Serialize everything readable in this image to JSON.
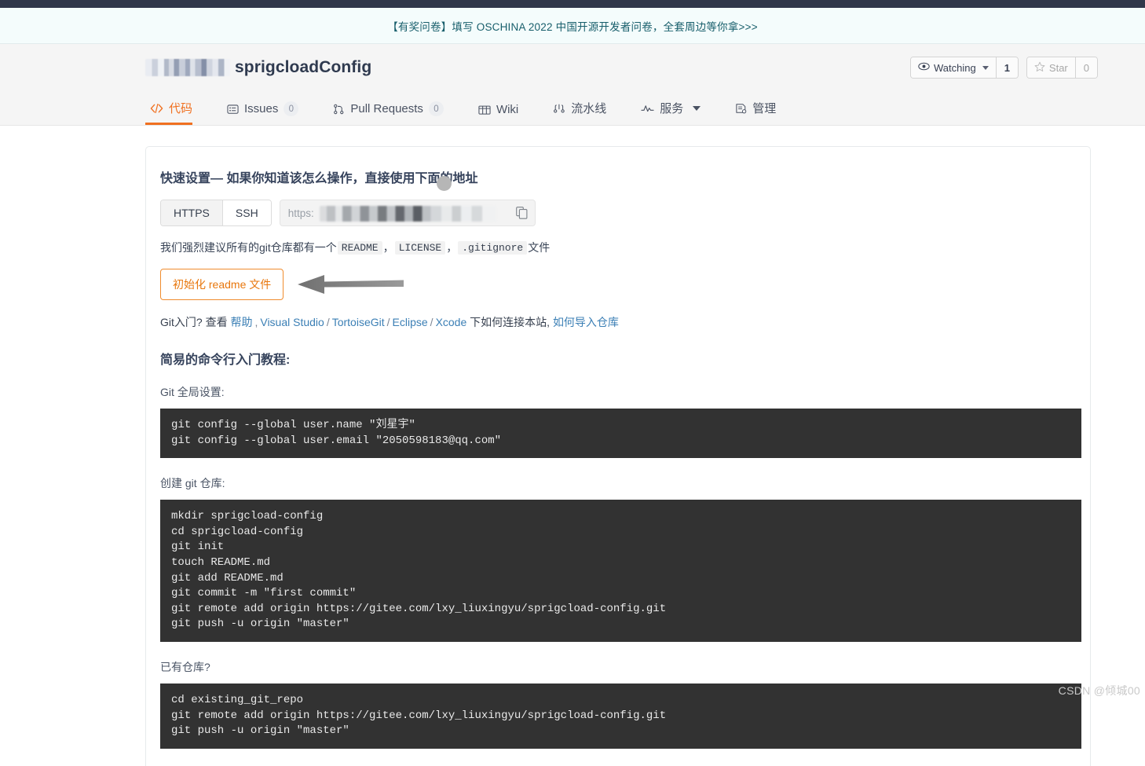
{
  "banner": {
    "text": "【有奖问卷】填写 OSCHINA 2022 中国开源开发者问卷，全套周边等你拿>>>"
  },
  "repo": {
    "owner_redacted": "",
    "name": "sprigcloadConfig",
    "watch": {
      "icon": "eye-icon",
      "label": "Watching",
      "count": "1"
    },
    "star": {
      "icon": "star-icon",
      "label": "Star",
      "count": "0"
    }
  },
  "tabs": [
    {
      "id": "code",
      "icon": "code-icon",
      "label": "代码",
      "badge": null,
      "active": true,
      "caret": false
    },
    {
      "id": "issues",
      "icon": "issue-icon",
      "label": "Issues",
      "badge": "0",
      "active": false,
      "caret": false
    },
    {
      "id": "pulls",
      "icon": "pull-request-icon",
      "label": "Pull Requests",
      "badge": "0",
      "active": false,
      "caret": false
    },
    {
      "id": "wiki",
      "icon": "book-icon",
      "label": "Wiki",
      "badge": null,
      "active": false,
      "caret": false
    },
    {
      "id": "pipeline",
      "icon": "pipeline-icon",
      "label": "流水线",
      "badge": null,
      "active": false,
      "caret": false
    },
    {
      "id": "service",
      "icon": "service-icon",
      "label": "服务",
      "badge": null,
      "active": false,
      "caret": true
    },
    {
      "id": "manage",
      "icon": "manage-icon",
      "label": "管理",
      "badge": null,
      "active": false,
      "caret": false
    }
  ],
  "quickstart": {
    "heading": "快速设置— 如果你知道该怎么操作，直接使用下面的地址",
    "protocols": [
      {
        "label": "HTTPS",
        "selected": true
      },
      {
        "label": "SSH",
        "selected": false
      }
    ],
    "url_prefix": "https:",
    "copy_icon": "copy-icon"
  },
  "advice": {
    "prefix": "我们强烈建议所有的git仓库都有一个",
    "files": [
      "README",
      "LICENSE",
      ".gitignore"
    ],
    "separator": "，",
    "suffix": "文件",
    "init_button": "初始化 readme 文件",
    "annotation_icon": "left-arrow-annotation"
  },
  "git_help": {
    "prefix": "Git入门?",
    "view": "查看",
    "links": [
      "帮助",
      "Visual Studio",
      "TortoiseGit",
      "Eclipse",
      "Xcode"
    ],
    "mid_text": "下如何连接本站,",
    "last_link": "如何导入仓库"
  },
  "tutorial": {
    "heading": "简易的命令行入门教程:",
    "sections": [
      {
        "label": "Git 全局设置:",
        "code": "git config --global user.name \"刘星宇\"\ngit config --global user.email \"2050598183@qq.com\""
      },
      {
        "label": "创建 git 仓库:",
        "code": "mkdir sprigcload-config\ncd sprigcload-config\ngit init\ntouch README.md\ngit add README.md\ngit commit -m \"first commit\"\ngit remote add origin https://gitee.com/lxy_liuxingyu/sprigcload-config.git\ngit push -u origin \"master\""
      },
      {
        "label": "已有仓库?",
        "code": "cd existing_git_repo\ngit remote add origin https://gitee.com/lxy_liuxingyu/sprigcload-config.git\ngit push -u origin \"master\""
      }
    ]
  },
  "watermark": {
    "text": "CSDN @倾城00"
  },
  "colors": {
    "accent": "#f07020",
    "topbar": "#30374a",
    "banner_bg": "#f4fcfc",
    "banner_text": "#175e6b",
    "code_bg": "#323232",
    "link": "#3b7fb5"
  }
}
